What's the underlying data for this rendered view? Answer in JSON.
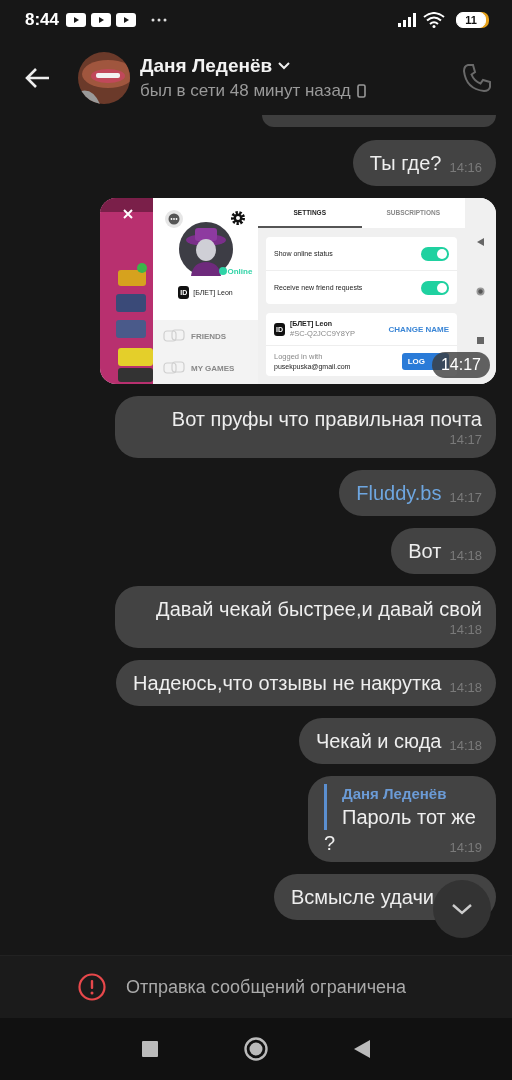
{
  "status_bar": {
    "time": "8:44",
    "battery": "11"
  },
  "header": {
    "name": "Даня Леденёв",
    "status": "был в сети 48 минут назад"
  },
  "messages": [
    {
      "kind": "cut"
    },
    {
      "kind": "text",
      "text": "Ты где?",
      "time": "14:16"
    },
    {
      "time": "14:17",
      "shot": {
        "tabs": [
          {
            "label": "SETTINGS",
            "selected": true
          },
          {
            "label": "SUBSCRIPTIONS",
            "selected": false
          }
        ],
        "profile": {
          "status": "Online",
          "id_badge": "ID",
          "name": "[БЛЕТ] Leon"
        },
        "menu": [
          "FRIENDS",
          "MY GAMES"
        ],
        "toggles": [
          {
            "label": "Show online status",
            "on": true
          },
          {
            "label": "Receive new friend requests",
            "on": true
          }
        ],
        "account": {
          "id_badge": "ID",
          "name": "[БЛЕТ] Leon",
          "tag": "#SC-Q2JCC9Y8YP",
          "action": "CHANGE NAME",
          "login_label": "Logged in with",
          "email": "pusekpuska@gmail.com",
          "logout": "LOG"
        }
      }
    },
    {
      "kind": "text",
      "text": "Вот пруфы что правильная почта",
      "time": "14:17"
    },
    {
      "kind": "link",
      "text": "Fluddy.bs",
      "time": "14:17"
    },
    {
      "kind": "text",
      "text": "Вот",
      "time": "14:18"
    },
    {
      "kind": "text",
      "text": "Давай чекай быстрее,и давай свой",
      "time": "14:18"
    },
    {
      "kind": "text",
      "text": "Надеюсь,что отзывы не накрутка",
      "time": "14:18"
    },
    {
      "kind": "text",
      "text": "Чекай и сюда",
      "time": "14:18"
    },
    {
      "kind": "reply",
      "quote_author": "Даня Леденёв",
      "quote_text": "Пароль тот же",
      "text": "?",
      "time": "14:19"
    },
    {
      "kind": "text",
      "text": "Всмысле удачи"
    }
  ],
  "notice": "Отправка сообщений ограничена"
}
